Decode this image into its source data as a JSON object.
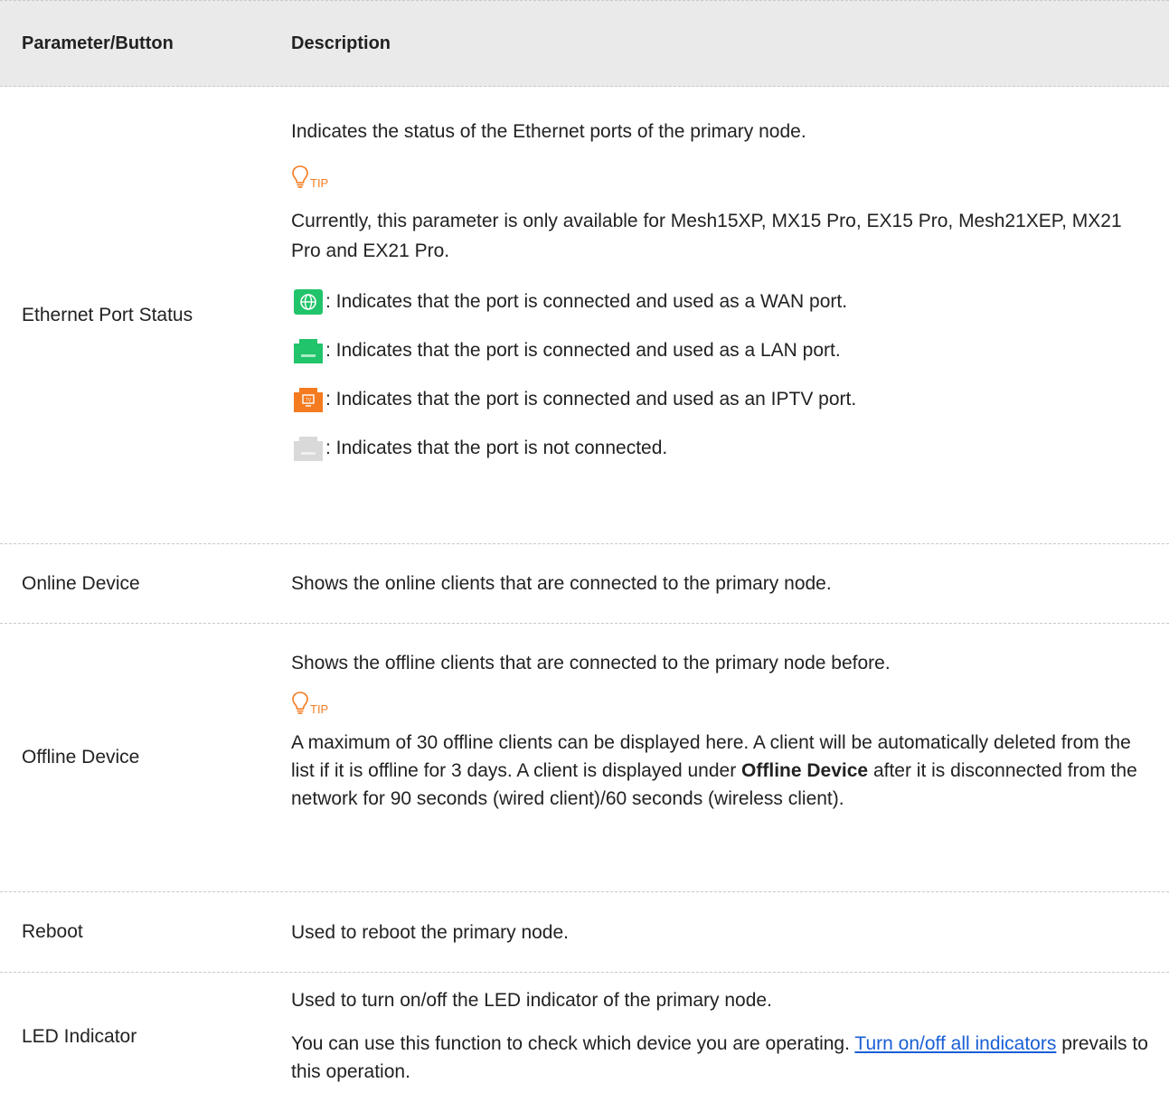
{
  "header": {
    "col1": "Parameter/Button",
    "col2": "Description"
  },
  "rows": {
    "ethernet": {
      "name": "Ethernet Port Status",
      "line1": "Indicates the status of the Ethernet ports of the primary node.",
      "tip_label": "TIP",
      "tip_text": "Currently, this parameter is only available for Mesh15XP, MX15 Pro, EX15 Pro, Mesh21XEP, MX21 Pro and EX21 Pro.",
      "wan": ": Indicates that the port is connected and used as a WAN port.",
      "lan": ": Indicates that the port is connected and used as a LAN port.",
      "iptv": ": Indicates that the port is connected and used as an IPTV port.",
      "none": ": Indicates that the port is not connected."
    },
    "online": {
      "name": "Online Device",
      "desc": "Shows the online clients that are connected to the primary node."
    },
    "offline": {
      "name": "Offline Device",
      "line1": "Shows the offline clients that are connected to the primary node before.",
      "tip_label": "TIP",
      "tip_part1": "A maximum of 30 offline clients can be displayed here. A client will be automatically deleted from the list if it is offline for 3 days. A client is displayed under ",
      "tip_bold": "Offline Device",
      "tip_part2": " after it is disconnected from the network for 90 seconds (wired client)/60 seconds (wireless client)."
    },
    "reboot": {
      "name": "Reboot",
      "desc": "Used to reboot the primary node."
    },
    "led": {
      "name": "LED Indicator",
      "line1": "Used to turn on/off the LED indicator of the primary node.",
      "line2_part1": "You can use this function to check which device you are operating. ",
      "link": "Turn on/off all indicators",
      "line2_part2": " prevails to this operation."
    }
  },
  "colors": {
    "tip": "#f47b20",
    "wan": "#21c46a",
    "lan": "#21c46a",
    "iptv": "#f47b20",
    "disconnected": "#d9d9d9",
    "link": "#1a5fd6"
  }
}
